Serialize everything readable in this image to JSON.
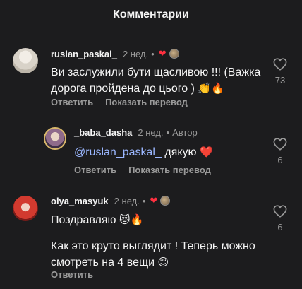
{
  "header": {
    "title": "Комментарии"
  },
  "comments": [
    {
      "username": "ruslan_paskal_",
      "time": "2 нед.",
      "text": "Ви заслужили бути щасливою !!! (Важка дорога пройдена до цього )",
      "emoji": "👏🔥",
      "reply_label": "Ответить",
      "translate_label": "Показать перевод",
      "likes": "73",
      "creator_liked": true
    },
    {
      "username": "_baba_dasha",
      "time": "2 нед.",
      "author_label": "Автор",
      "mention": "@ruslan_paskal_",
      "text": "дякую",
      "emoji": "❤️",
      "reply_label": "Ответить",
      "translate_label": "Показать перевод",
      "likes": "6"
    },
    {
      "username": "olya_masyuk",
      "time": "2 нед.",
      "text_line1": "Поздравляю",
      "emoji1": "😻🔥",
      "text_line2": "Как это круто выглядит ! Теперь можно смотреть на 4 вещи",
      "emoji2": "😌",
      "reply_label": "Ответить",
      "likes": "6",
      "creator_liked": true
    }
  ],
  "icons": {
    "like": "heart-outline-icon",
    "creator_like": "heart-filled-icon"
  },
  "colors": {
    "background": "#1c1c1e",
    "heart": "#ff3040",
    "mention": "#9bb7ff"
  }
}
